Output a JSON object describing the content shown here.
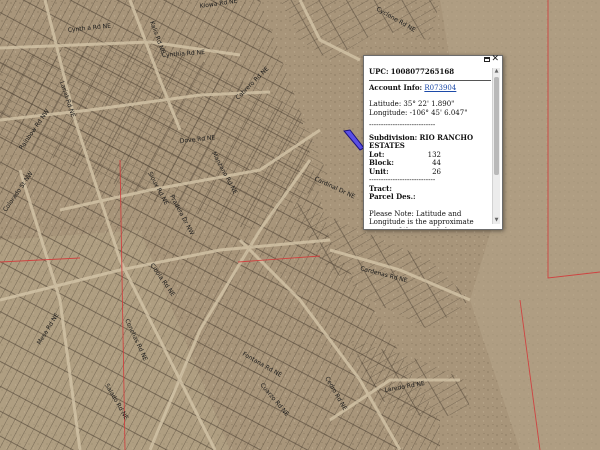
{
  "map": {
    "streets": [
      "Cynth a Rd NE",
      "Cynthia Rd NE",
      "Kiowa Rd NE",
      "Cyclone Rd NE",
      "Kalis Rd NE",
      "Lariat Rd NE",
      "Dove Rd NE",
      "Cabrero Rd NE",
      "Cardinal Dr NE",
      "Colorado St NW",
      "Rainbow Rd NW",
      "Pradera Dr NW",
      "Sioux Rd NE",
      "Manzano Rd NE",
      "Cibola Rd NE",
      "Conchas Rd NE",
      "Mesa Rd NE",
      "Salado Rd NE",
      "Cuarzo Rd NE",
      "Cedro Rd NE",
      "Cardenas Rd NE",
      "Laredo Rd NE",
      "Fontana Rd NE"
    ]
  },
  "popup": {
    "upc_label": "UPC:",
    "upc_value": "1008077265168",
    "account_label": "Account Info:",
    "account_value": "R073904",
    "latitude_label": "Latitude:",
    "latitude_value": "35° 22' 1.890\"",
    "longitude_label": "Longitude:",
    "longitude_value": "-106° 45' 6.047\"",
    "separator": "----------------------------",
    "subdivision_label": "Subdivision:",
    "subdivision_value": "RIO RANCHO ESTATES",
    "lot_label": "Lot:",
    "lot_value": "132",
    "block_label": "Block:",
    "block_value": "44",
    "unit_label": "Unit:",
    "unit_value": "26",
    "tract_label": "Tract:",
    "parcel_label": "Parcel Des.:",
    "note": "Please Note: Latitude and Longitude is the approximate center of the parcel shown."
  },
  "colors": {
    "terrain": "#a8957a",
    "parcel_lines": "#4a3f32",
    "boundary": "#d23a3a",
    "highlight": "#3a2fd6"
  }
}
